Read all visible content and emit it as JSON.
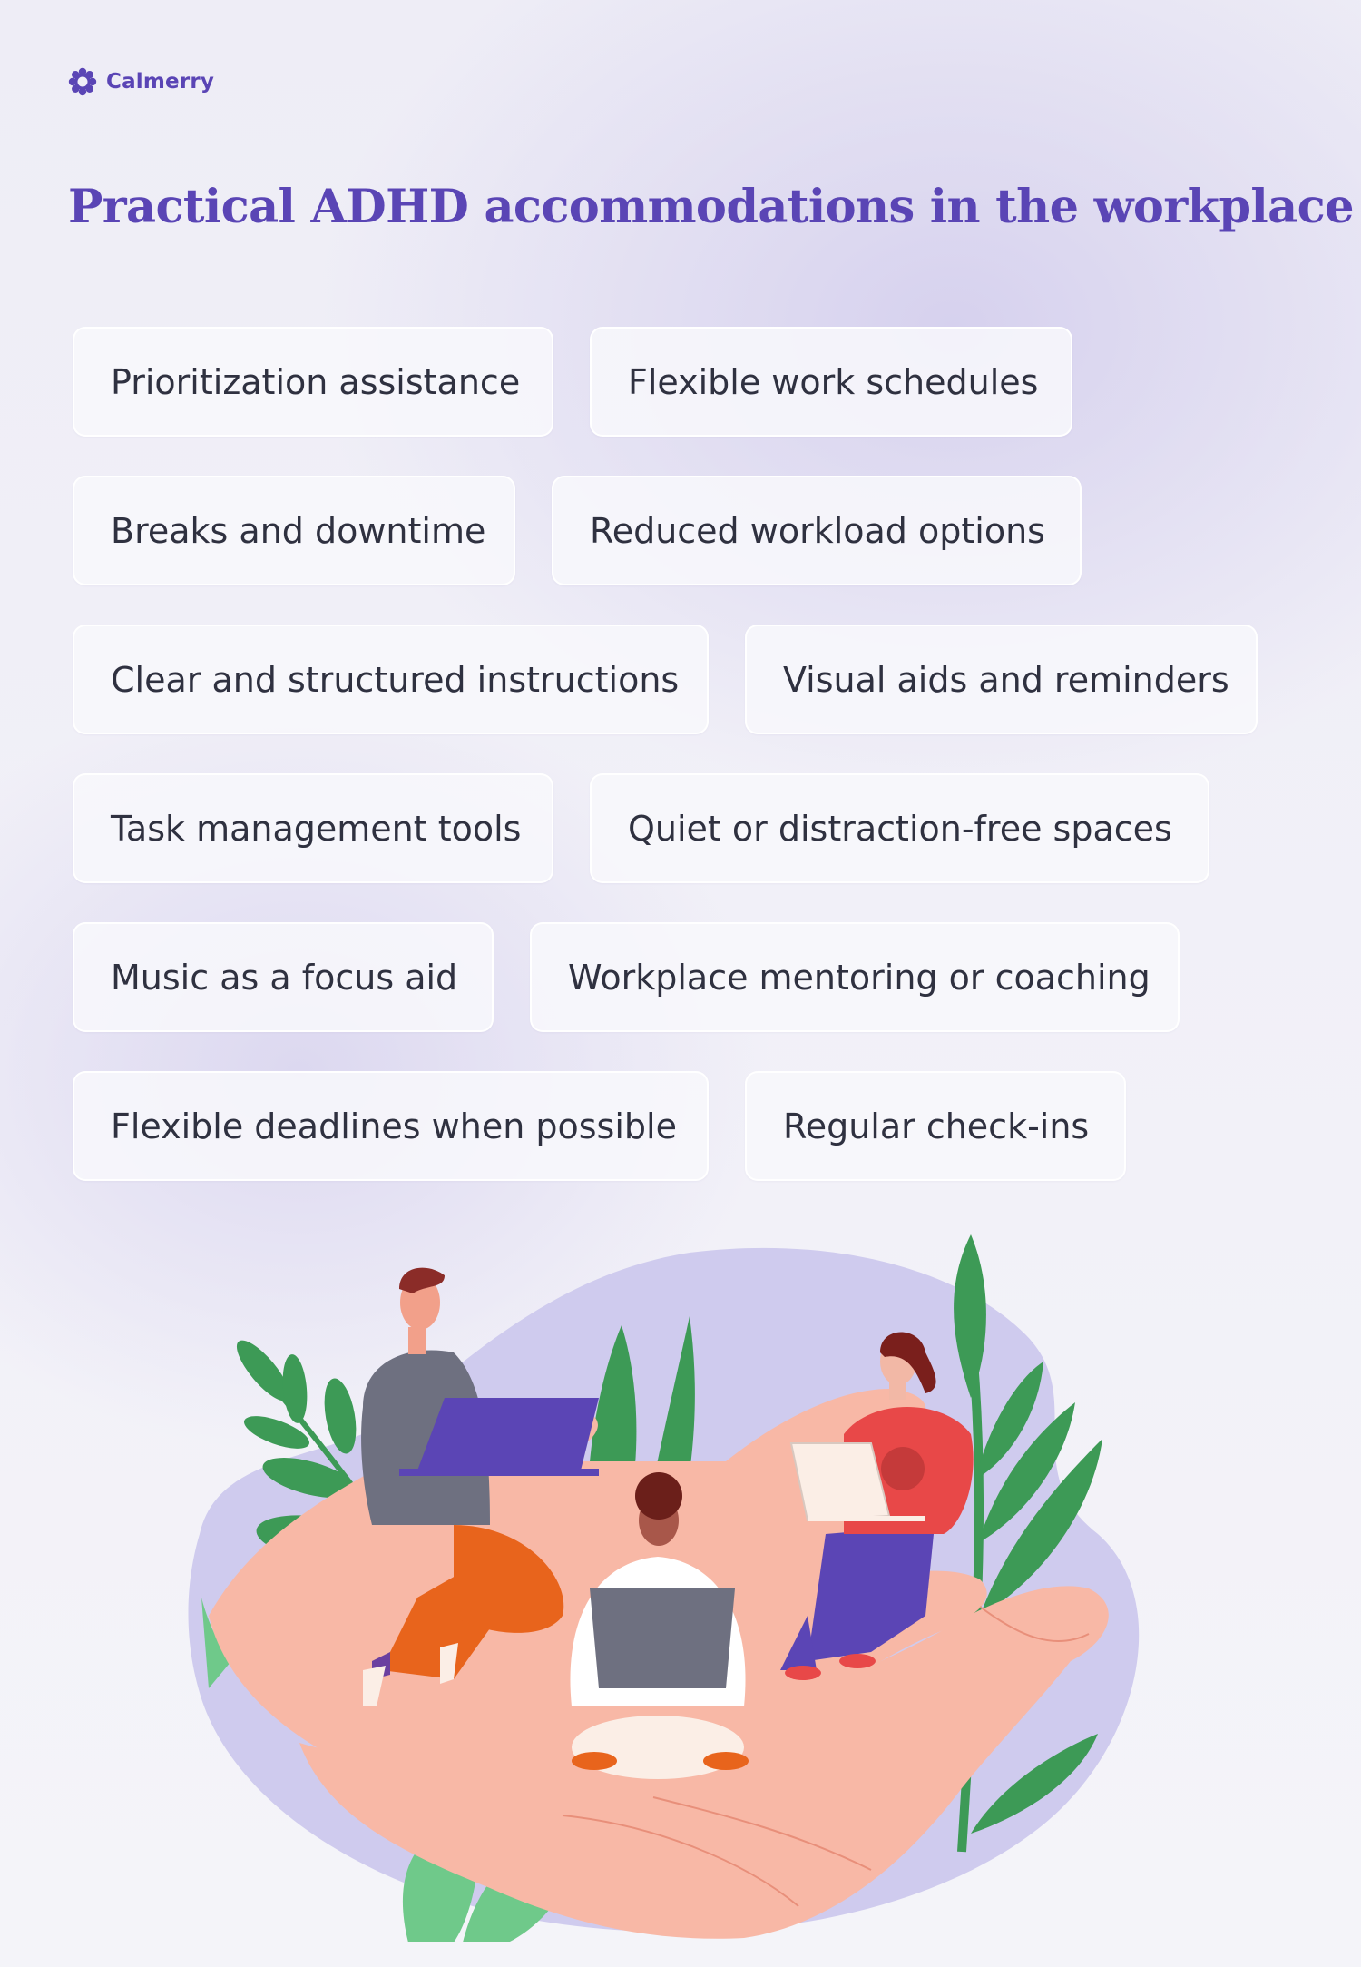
{
  "brand": {
    "name": "Calmerry",
    "icon": "flower-logo-icon",
    "color": "#5a45b5"
  },
  "title": "Practical ADHD accommodations in the workplace",
  "accommodations": [
    "Prioritization assistance",
    "Flexible work schedules",
    "Breaks and downtime",
    "Reduced workload options",
    "Clear and structured instructions",
    "Visual aids and reminders",
    "Task management tools",
    "Quiet or distraction-free spaces",
    "Music as a focus aid",
    "Workplace mentoring or coaching",
    "Flexible deadlines when possible",
    "Regular check-ins"
  ],
  "illustration": {
    "description": "Three people working on laptops while sitting on open hands, surrounded by plants",
    "colors": {
      "blob": "#cfcbee",
      "hand": "#f8b8a6",
      "leaf": "#3d9a56",
      "leaf_light": "#6fc98a",
      "purple": "#5b45b5",
      "orange": "#e8641c",
      "red": "#e84848",
      "gray": "#6e7080"
    }
  }
}
